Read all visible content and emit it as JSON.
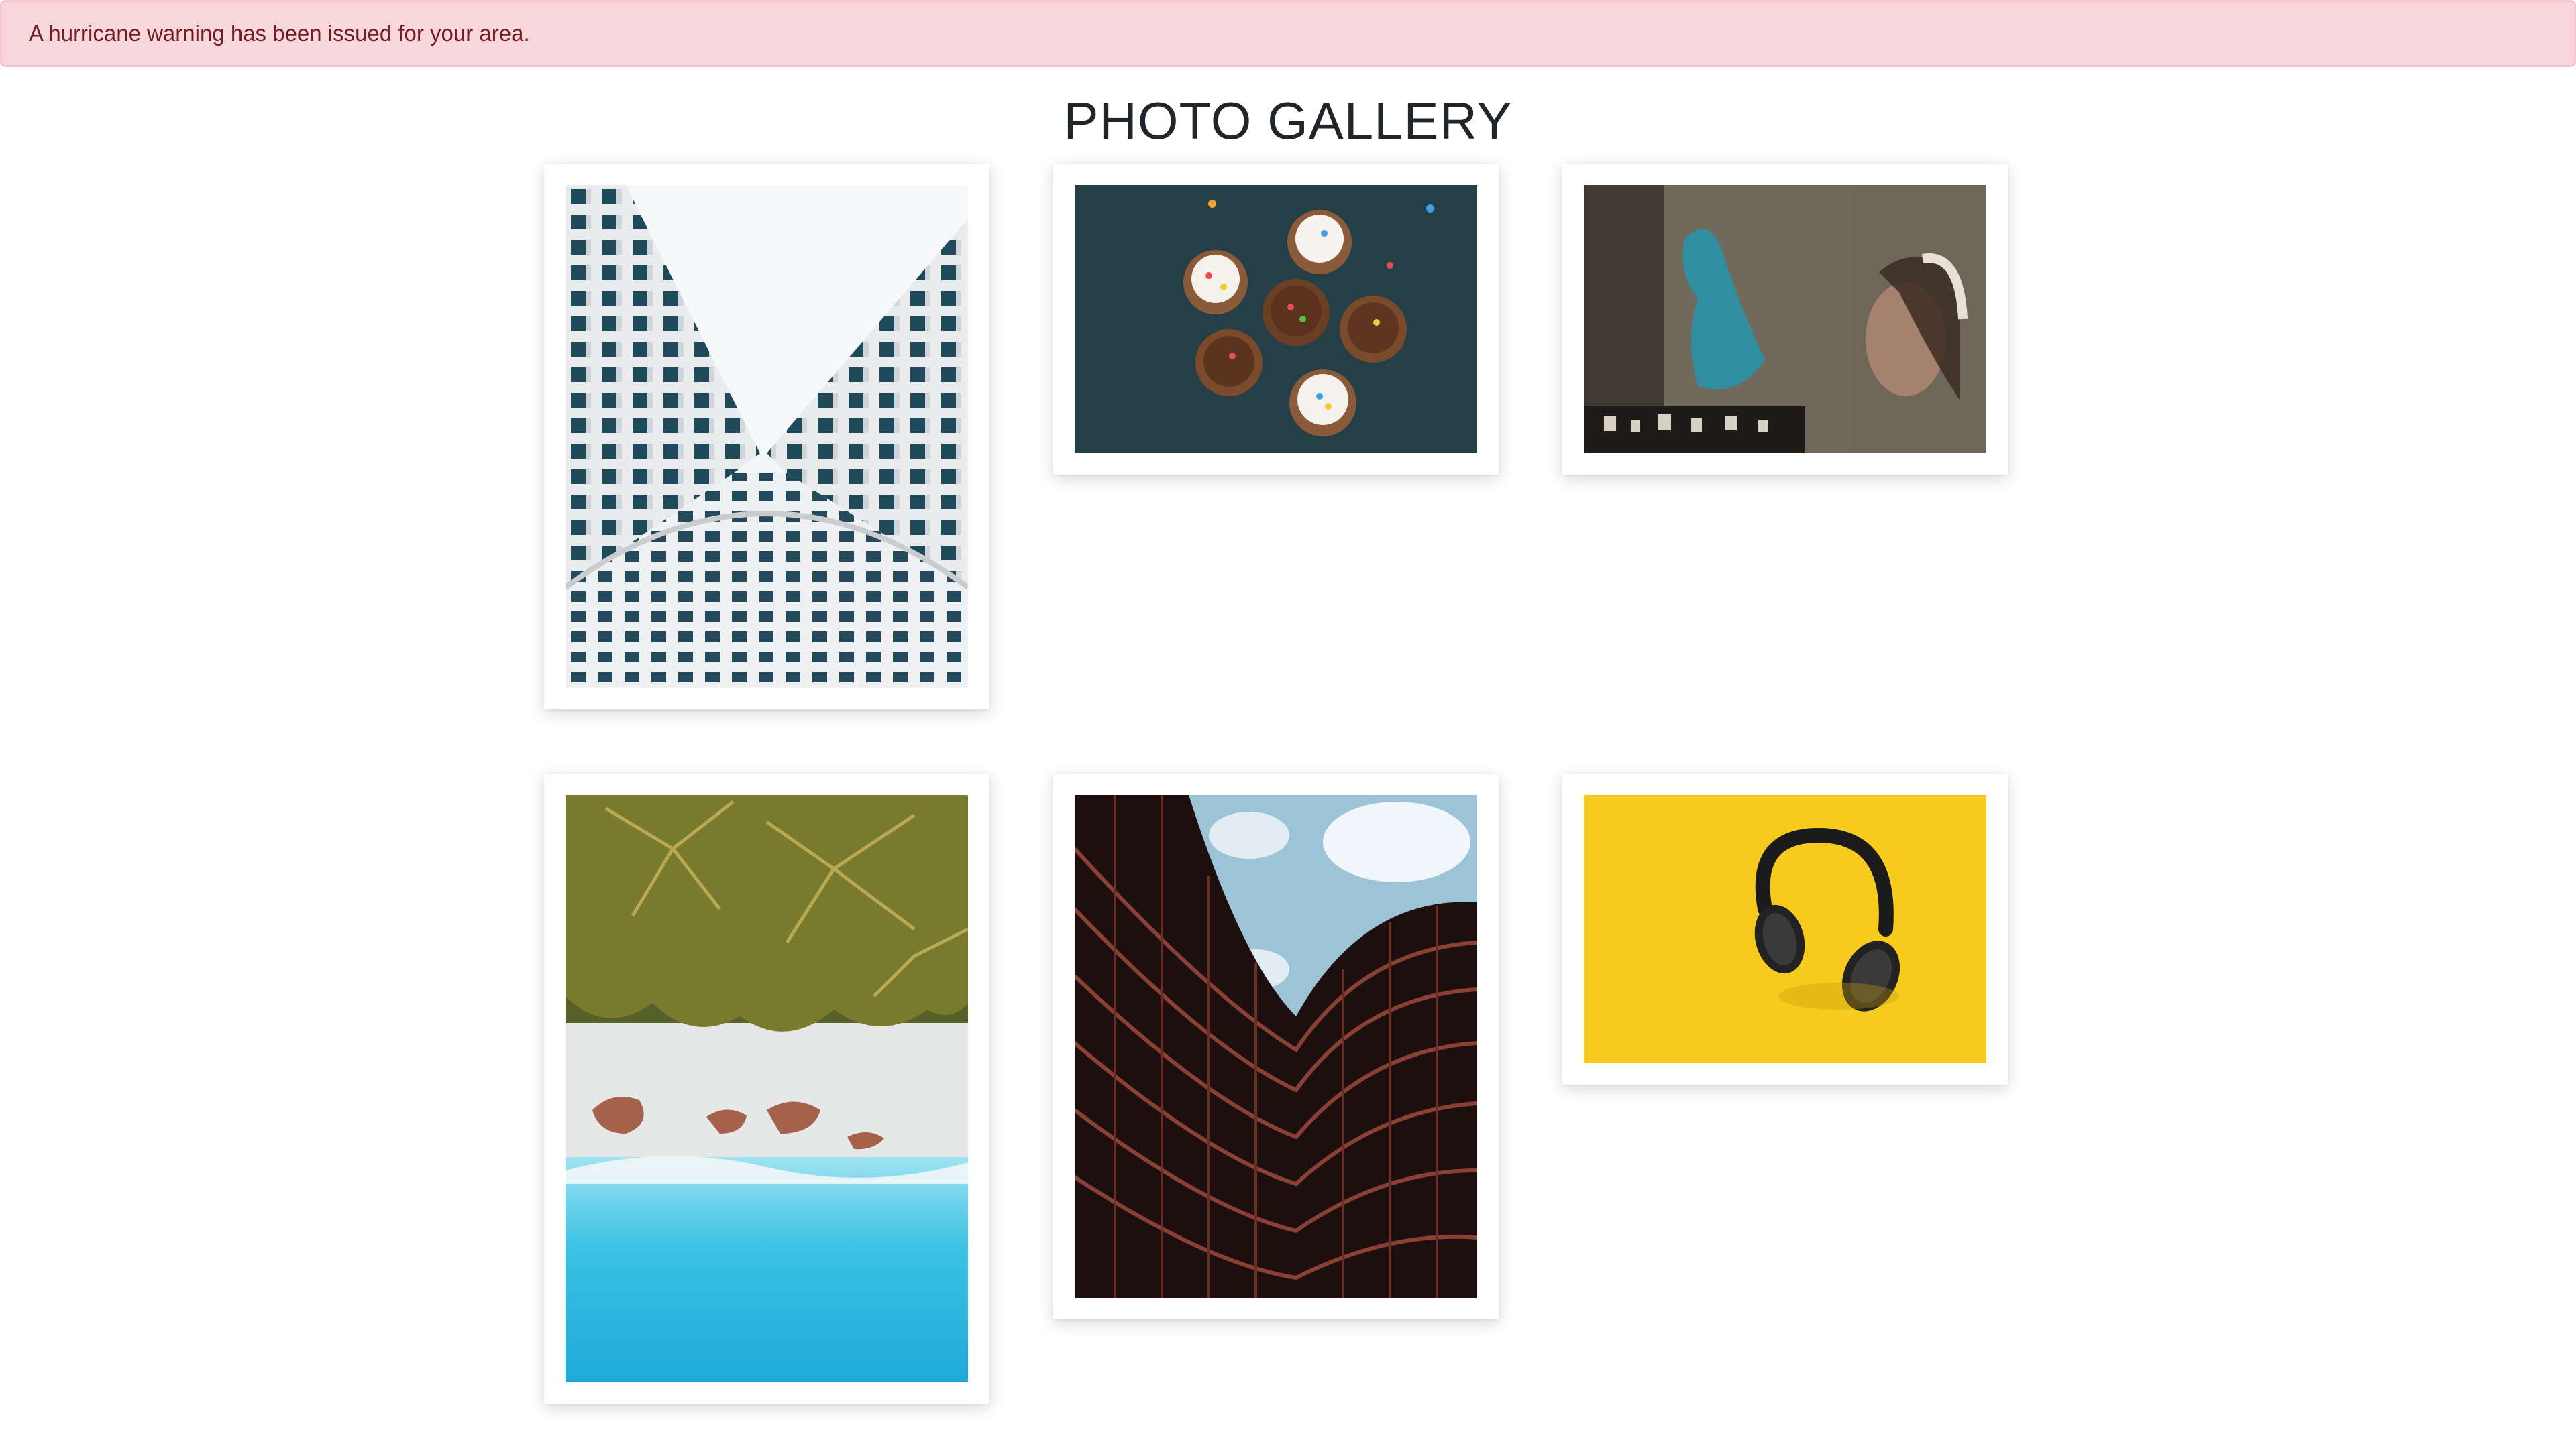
{
  "alert": {
    "text": "A hurricane warning has been issued for your area.",
    "background": "#f8d7da",
    "text_color": "#721c24"
  },
  "gallery": {
    "title": "PHOTO GALLERY",
    "photos": [
      {
        "subject": "building-looking-up"
      },
      {
        "subject": "cupcakes"
      },
      {
        "subject": "graffiti-and-headphones-person"
      },
      {
        "subject": "beach-palm-trees-aerial"
      },
      {
        "subject": "curved-building-facade"
      },
      {
        "subject": "headphones-on-yellow"
      }
    ]
  }
}
